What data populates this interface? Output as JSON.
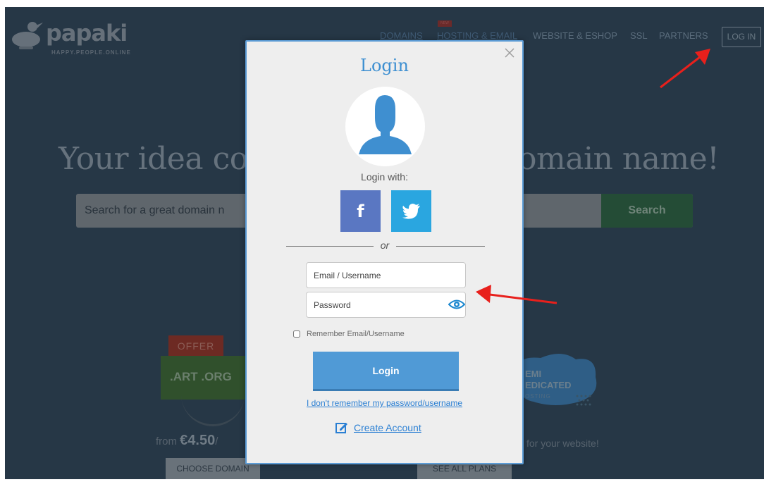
{
  "site": {
    "brand": "papaki",
    "tagline": "HAPPY.PEOPLE.ONLINE",
    "new_badge": "NEW",
    "nav": {
      "domains": "DOMAINS",
      "hosting": "HOSTING & EMAIL",
      "website": "WEBSITE & ESHOP",
      "ssl": "SSL",
      "partners": "PARTNERS",
      "login": "LOG IN"
    },
    "hero_left": "Your idea co",
    "hero_right": "omain name!",
    "search": {
      "placeholder_visible": "Search for a great domain n",
      "button": "Search"
    },
    "promo_left": {
      "tag": "OFFER",
      "banner": ".ART .ORG",
      "from_prefix": "from ",
      "price": "€4.50",
      "price_suffix": "/",
      "button": "CHOOSE DOMAIN"
    },
    "promo_right": {
      "title": "EMI\nEDICATED",
      "subtitle": "OSTING",
      "text": "for your website!",
      "button": "SEE ALL PLANS"
    }
  },
  "modal": {
    "title": "Login",
    "login_with": "Login with:",
    "facebook_letter": "f",
    "or": "or",
    "email_placeholder": "Email / Username",
    "password_placeholder": "Password",
    "remember_label": "Remember Email/Username",
    "submit": "Login",
    "forgot": "I don't remember my password/username",
    "create_account": "Create Account"
  },
  "colors": {
    "modal_bg": "#eeeeee",
    "modal_border": "#5b9bd5",
    "accent_blue": "#509ad6",
    "facebook": "#5a77c2",
    "twitter": "#2aa6e0",
    "annotation_arrow": "#e8201c",
    "overlay_bg": "#263746"
  },
  "icons": {
    "close": "close-icon",
    "avatar": "user-silhouette-icon",
    "facebook": "facebook-icon",
    "twitter": "twitter-icon",
    "eye": "eye-icon",
    "create": "edit-icon"
  }
}
